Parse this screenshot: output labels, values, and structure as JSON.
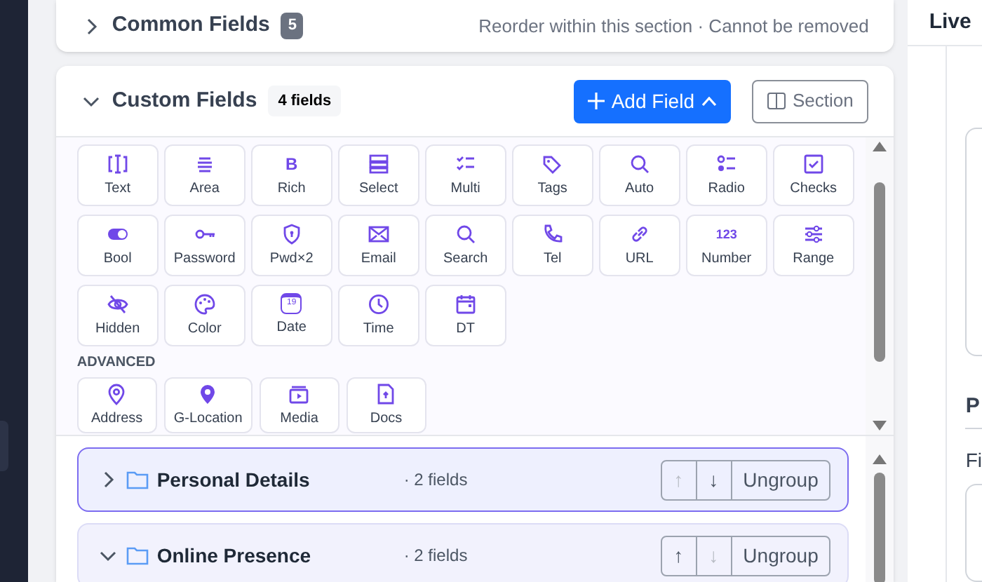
{
  "common_fields": {
    "title": "Common Fields",
    "count": "5",
    "expanded": false,
    "note": "Reorder within this section · Cannot be removed"
  },
  "custom_fields": {
    "title": "Custom Fields",
    "count": "4 fields",
    "expanded": true,
    "add_button": "Add Field",
    "section_button": "Section"
  },
  "field_types": [
    {
      "label": "Text"
    },
    {
      "label": "Area"
    },
    {
      "label": "Rich",
      "icon_text": "B"
    },
    {
      "label": "Select"
    },
    {
      "label": "Multi"
    },
    {
      "label": "Tags"
    },
    {
      "label": "Auto"
    },
    {
      "label": "Radio"
    },
    {
      "label": "Checks"
    },
    {
      "label": "Bool"
    },
    {
      "label": "Password"
    },
    {
      "label": "Pwd×2"
    },
    {
      "label": "Email"
    },
    {
      "label": "Search"
    },
    {
      "label": "Tel"
    },
    {
      "label": "URL"
    },
    {
      "label": "Number",
      "icon_text": "123"
    },
    {
      "label": "Range"
    },
    {
      "label": "Hidden"
    },
    {
      "label": "Color"
    },
    {
      "label": "Date",
      "icon_text": "19"
    },
    {
      "label": "Time"
    },
    {
      "label": "DT"
    }
  ],
  "advanced": {
    "heading": "ADVANCED",
    "items": [
      {
        "label": "Address"
      },
      {
        "label": "G-Location"
      },
      {
        "label": "Media"
      },
      {
        "label": "Docs"
      }
    ]
  },
  "groups": [
    {
      "name": "Personal Details",
      "count": "· 2 fields",
      "selected": true,
      "expanded": false,
      "up_disabled": true,
      "down_disabled": false,
      "ungroup": "Ungroup",
      "up": "↑",
      "down": "↓"
    },
    {
      "name": "Online Presence",
      "count": "· 2 fields",
      "selected": false,
      "expanded": true,
      "up_disabled": false,
      "down_disabled": true,
      "ungroup": "Ungroup",
      "up": "↑",
      "down": "↓"
    }
  ],
  "preview": {
    "title": "Live",
    "section_letter": "P",
    "field_letters": "Fi"
  }
}
